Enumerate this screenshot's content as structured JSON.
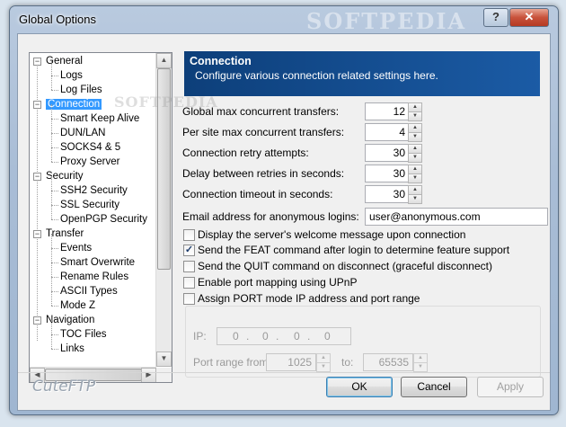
{
  "window": {
    "title": "Global Options",
    "watermark": "SOFTPEDIA"
  },
  "tree": {
    "items": [
      {
        "label": "General",
        "level": 0,
        "expander": "−"
      },
      {
        "label": "Logs",
        "level": 1
      },
      {
        "label": "Log Files",
        "level": 1
      },
      {
        "label": "Connection",
        "level": 0,
        "expander": "−",
        "selected": true
      },
      {
        "label": "Smart Keep Alive",
        "level": 1
      },
      {
        "label": "DUN/LAN",
        "level": 1
      },
      {
        "label": "SOCKS4 & 5",
        "level": 1
      },
      {
        "label": "Proxy Server",
        "level": 1
      },
      {
        "label": "Security",
        "level": 0,
        "expander": "−"
      },
      {
        "label": "SSH2 Security",
        "level": 1
      },
      {
        "label": "SSL Security",
        "level": 1
      },
      {
        "label": "OpenPGP Security",
        "level": 1
      },
      {
        "label": "Transfer",
        "level": 0,
        "expander": "−"
      },
      {
        "label": "Events",
        "level": 1
      },
      {
        "label": "Smart Overwrite",
        "level": 1
      },
      {
        "label": "Rename Rules",
        "level": 1
      },
      {
        "label": "ASCII Types",
        "level": 1
      },
      {
        "label": "Mode Z",
        "level": 1
      },
      {
        "label": "Navigation",
        "level": 0,
        "expander": "−"
      },
      {
        "label": "TOC Files",
        "level": 1
      },
      {
        "label": "Links",
        "level": 1
      }
    ]
  },
  "panel": {
    "title": "Connection",
    "subtitle": "Configure various connection related settings here.",
    "fields": {
      "max_transfers_label": "Global max concurrent transfers:",
      "max_transfers_value": "12",
      "per_site_label": "Per site max concurrent transfers:",
      "per_site_value": "4",
      "retry_label": "Connection retry attempts:",
      "retry_value": "30",
      "delay_label": "Delay between retries in seconds:",
      "delay_value": "30",
      "timeout_label": "Connection timeout in seconds:",
      "timeout_value": "30",
      "email_label": "Email address for anonymous logins:",
      "email_value": "user@anonymous.com"
    },
    "checkboxes": {
      "welcome": {
        "label": "Display the server's welcome message upon connection",
        "checked": false
      },
      "feat": {
        "label": "Send the FEAT command after login to determine feature support",
        "checked": true
      },
      "quit": {
        "label": "Send the QUIT command on disconnect (graceful disconnect)",
        "checked": false
      },
      "upnp": {
        "label": "Enable port mapping using UPnP",
        "checked": false
      },
      "port_ip": {
        "label": "Assign PORT mode IP address and port range",
        "checked": false
      }
    },
    "port_group": {
      "ip_label": "IP:",
      "ip_octets": [
        "0",
        "0",
        "0",
        "0"
      ],
      "range_from_label": "Port range from:",
      "range_from_value": "1025",
      "range_to_label": "to:",
      "range_to_value": "65535"
    }
  },
  "footer": {
    "brand": "CuteFTP",
    "ok": "OK",
    "cancel": "Cancel",
    "apply": "Apply"
  },
  "titlebar_buttons": {
    "help": "?",
    "close": "✕"
  },
  "check_glyph": "✓",
  "colors": {
    "header_bg": "#0d3f7a",
    "selection": "#3399ff"
  }
}
